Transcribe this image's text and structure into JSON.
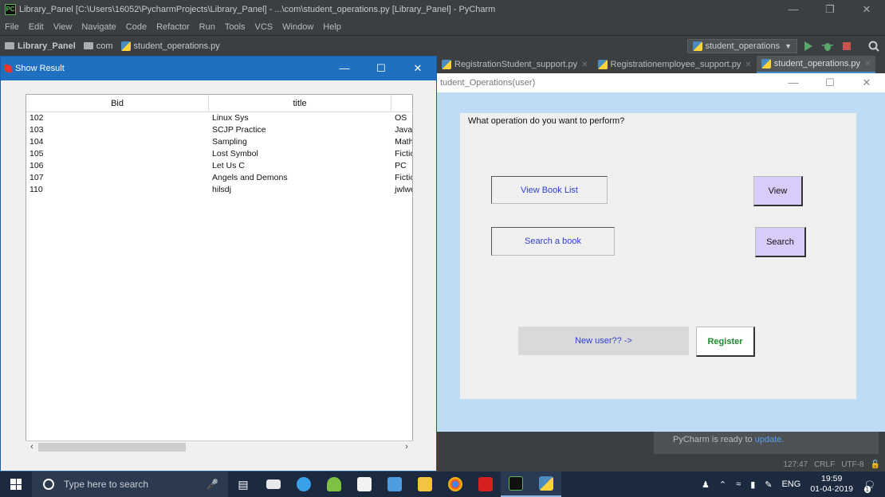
{
  "pycharm": {
    "window_title": "Library_Panel [C:\\Users\\16052\\PycharmProjects\\Library_Panel] - ...\\com\\student_operations.py [Library_Panel] - PyCharm",
    "app_icon_text": "PC",
    "menu": [
      "File",
      "Edit",
      "View",
      "Navigate",
      "Code",
      "Refactor",
      "Run",
      "Tools",
      "VCS",
      "Window",
      "Help"
    ],
    "breadcrumb": [
      "Library_Panel",
      "com",
      "student_operations.py"
    ],
    "run_config": "student_operations",
    "tabs": [
      {
        "label": "RegistrationStudent_support.py",
        "active": false
      },
      {
        "label": "Registrationemployee_support.py",
        "active": false
      },
      {
        "label": "student_operations.py",
        "active": true
      }
    ],
    "notification": {
      "text": "PyCharm is ready to ",
      "link": "update."
    },
    "status": {
      "position": "127:47",
      "line_sep": "CRLF",
      "encoding": "UTF-8"
    }
  },
  "result_window": {
    "title": "Show Result",
    "columns": [
      "Bid",
      "title",
      ""
    ],
    "rows": [
      [
        "102",
        "Linux Sys",
        "OS"
      ],
      [
        "103",
        "SCJP Practice",
        "Java"
      ],
      [
        "104",
        "Sampling",
        "Math"
      ],
      [
        "105",
        "Lost Symbol",
        "Fiction"
      ],
      [
        "106",
        "Let Us C",
        "PC"
      ],
      [
        "107",
        "Angels and Demons",
        "Fiction"
      ],
      [
        "110",
        "hilsdj",
        "jwlwe"
      ]
    ]
  },
  "student_window": {
    "title": "tudent_Operations(user)",
    "question": "What operation do you want to perform?",
    "view_label": "View Book List",
    "view_button": "View",
    "search_label": "Search a book",
    "search_button": "Search",
    "new_user_label": "New user?? ->",
    "register_button": "Register"
  },
  "taskbar": {
    "search_placeholder": "Type here to search",
    "language": "ENG",
    "time": "19:59",
    "date": "01-04-2019",
    "notification_count": "1"
  },
  "colors": {
    "accent_blue": "#1f70c1",
    "student_bg": "#bfdcf7",
    "button_purple": "#d8cdfa",
    "register_green": "#1f8a2e",
    "label_blue": "#2f3fd0"
  }
}
